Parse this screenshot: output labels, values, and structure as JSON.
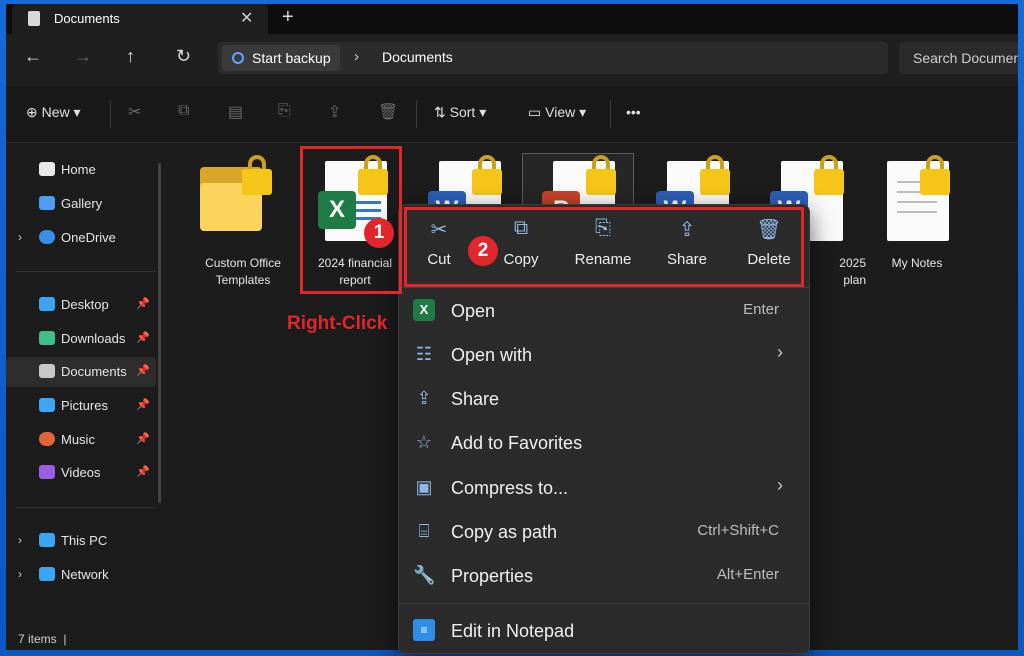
{
  "window": {
    "tab_title": "Documents",
    "tab_close": "✕",
    "tab_new": "+"
  },
  "address": {
    "back": "←",
    "forward": "→",
    "up": "↑",
    "refresh": "↻",
    "backup_label": "Start backup",
    "separator": "›",
    "location": "Documents",
    "search_placeholder": "Search Documents"
  },
  "toolbar": {
    "new_label": "New",
    "sort_label": "Sort",
    "view_label": "View",
    "more_label": "•••",
    "cut_icon": "✂",
    "copy_icon": "⧉",
    "paste_icon": "▤",
    "rename_icon": "⎘",
    "share_icon": "⇪",
    "delete_icon": "🗑"
  },
  "sidebar": {
    "items": [
      {
        "label": "Home",
        "color": "#e8e8e8"
      },
      {
        "label": "Gallery",
        "color": "#4c9ef0"
      },
      {
        "label": "OneDrive",
        "color": "#3a8ee6"
      },
      {
        "label": "Desktop",
        "color": "#3aa6f2"
      },
      {
        "label": "Downloads",
        "color": "#3fbf8a"
      },
      {
        "label": "Documents",
        "color": "#c7c7c7"
      },
      {
        "label": "Pictures",
        "color": "#3fa5f5"
      },
      {
        "label": "Music",
        "color": "#e3643b"
      },
      {
        "label": "Videos",
        "color": "#9b5fe0"
      },
      {
        "label": "This PC",
        "color": "#3aa6f2"
      },
      {
        "label": "Network",
        "color": "#3aa6f2"
      }
    ],
    "pin": "📌",
    "chevron": "›"
  },
  "files": [
    {
      "name_line1": "Custom Office",
      "name_line2": "Templates"
    },
    {
      "name_line1": "2024 financial",
      "name_line2": "report",
      "badge": "X",
      "badge_color": "#1e7b45"
    },
    {
      "name_line1": "",
      "name_line2": "",
      "badge": "W",
      "badge_color": "#2b5fb8"
    },
    {
      "name_line1": "",
      "name_line2": "",
      "badge": "P",
      "badge_color": "#c5432a"
    },
    {
      "name_line1": "",
      "name_line2": "",
      "badge": "W",
      "badge_color": "#2b5fb8"
    },
    {
      "name_line1": "2025",
      "name_line2": "plan",
      "badge": "W",
      "badge_color": "#2b5fb8"
    },
    {
      "name_line1": "My Notes",
      "name_line2": ""
    }
  ],
  "status": {
    "items_count": "7 items",
    "divider": "|"
  },
  "context_menu": {
    "quick_actions": {
      "cut": "Cut",
      "copy": "Copy",
      "rename": "Rename",
      "share": "Share",
      "delete": "Delete"
    },
    "items": {
      "open": {
        "label": "Open",
        "shortcut": "Enter"
      },
      "open_with": {
        "label": "Open with"
      },
      "share": {
        "label": "Share"
      },
      "favorites": {
        "label": "Add to Favorites"
      },
      "compress": {
        "label": "Compress to..."
      },
      "copy_path": {
        "label": "Copy as path",
        "shortcut": "Ctrl+Shift+C"
      },
      "properties": {
        "label": "Properties",
        "shortcut": "Alt+Enter"
      },
      "notepad": {
        "label": "Edit in Notepad"
      }
    },
    "arrow": "›"
  },
  "annotations": {
    "step1": "1",
    "step2": "2",
    "right_click": "Right-Click",
    "accent": "#e1262c"
  }
}
